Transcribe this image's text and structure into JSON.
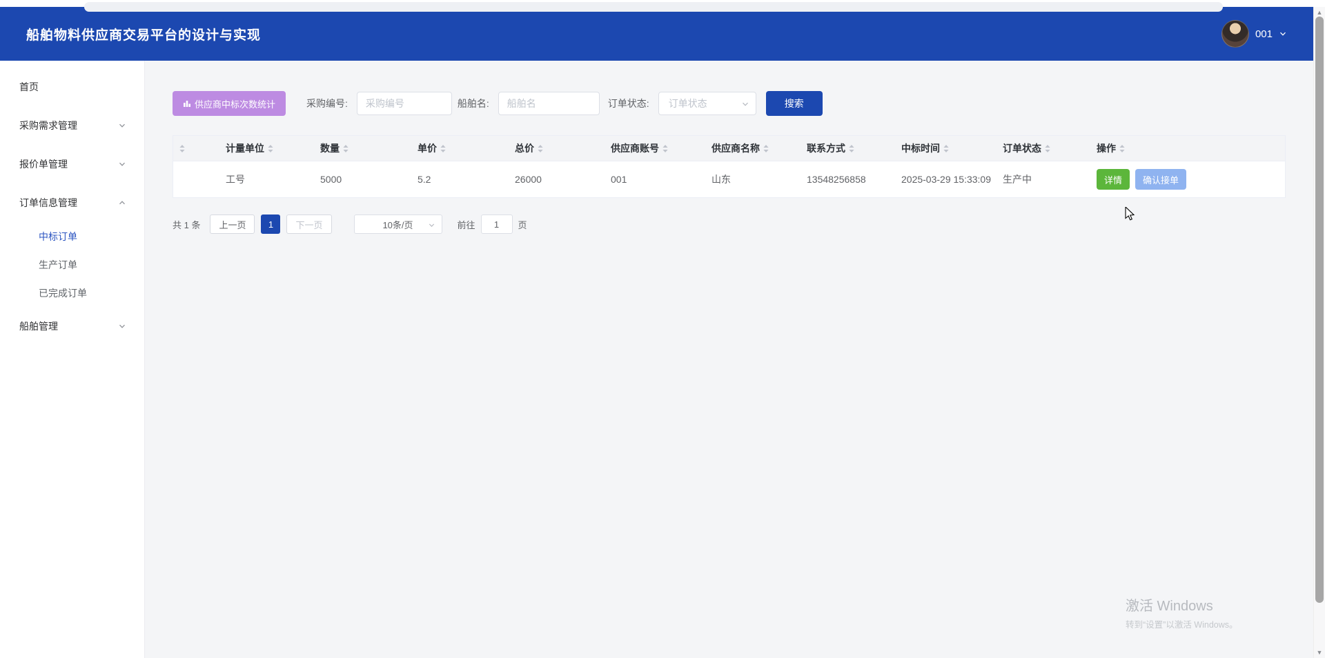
{
  "header": {
    "title": "船舶物料供应商交易平台的设计与实现",
    "username": "001"
  },
  "sidebar": {
    "items": [
      {
        "label": "首页"
      },
      {
        "label": "采购需求管理"
      },
      {
        "label": "报价单管理"
      },
      {
        "label": "订单信息管理"
      },
      {
        "label": "船舶管理"
      }
    ],
    "order_children": [
      {
        "label": "中标订单"
      },
      {
        "label": "生产订单"
      },
      {
        "label": "已完成订单"
      }
    ]
  },
  "filters": {
    "stats_button": "供应商中标次数统计",
    "purchase_label": "采购编号:",
    "purchase_placeholder": "采购编号",
    "ship_label": "船舶名:",
    "ship_placeholder": "船舶名",
    "status_label": "订单状态:",
    "status_placeholder": "订单状态",
    "search_button": "搜索"
  },
  "table": {
    "columns": [
      "",
      "计量单位",
      "数量",
      "单价",
      "总价",
      "供应商账号",
      "供应商名称",
      "联系方式",
      "中标时间",
      "订单状态",
      "操作"
    ],
    "rows": [
      {
        "unit": "工号",
        "quantity": "5000",
        "unit_price": "5.2",
        "total_price": "26000",
        "supplier_account": "001",
        "supplier_name": "山东",
        "contact": "13548256858",
        "win_time": "2025-03-29 15:33:09",
        "status": "生产中"
      }
    ],
    "row_actions": {
      "detail": "详情",
      "confirm": "确认接单"
    }
  },
  "pagination": {
    "total_text": "共 1 条",
    "prev": "上一页",
    "current_page": "1",
    "next": "下一页",
    "page_size": "10条/页",
    "goto_label": "前往",
    "goto_value": "1",
    "page_unit": "页"
  },
  "watermark": {
    "line1": "激活 Windows",
    "line2": "转到“设置”以激活 Windows。"
  },
  "colors": {
    "primary": "#1c48b0",
    "purple": "#bd8be2",
    "green": "#5cb63b",
    "light_blue": "#8fb3f0",
    "active_link": "#2b54c0"
  }
}
